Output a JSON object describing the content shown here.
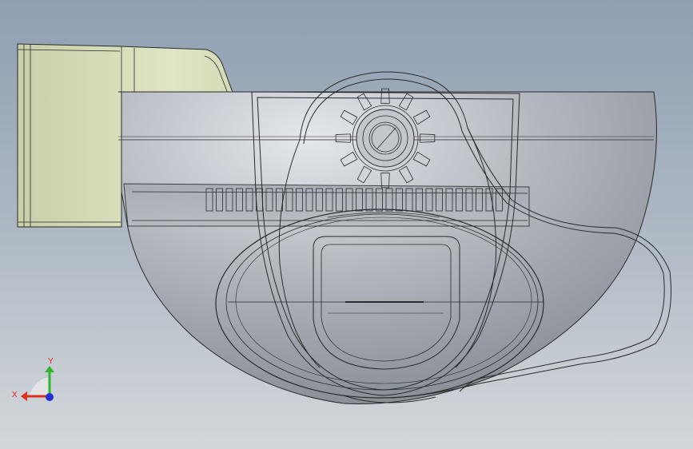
{
  "viewport": {
    "background_top": "#8f9fb2",
    "background_bottom": "#d3d7db"
  },
  "model": {
    "body_color": "#a7acb4",
    "bracket_color": "#d4d9b7",
    "edge_color": "#2a2a2a"
  },
  "triad": {
    "x_label": "X",
    "y_label": "Y",
    "x_color": "#e0301e",
    "y_color": "#2fb52f",
    "z_color": "#2030d0"
  }
}
